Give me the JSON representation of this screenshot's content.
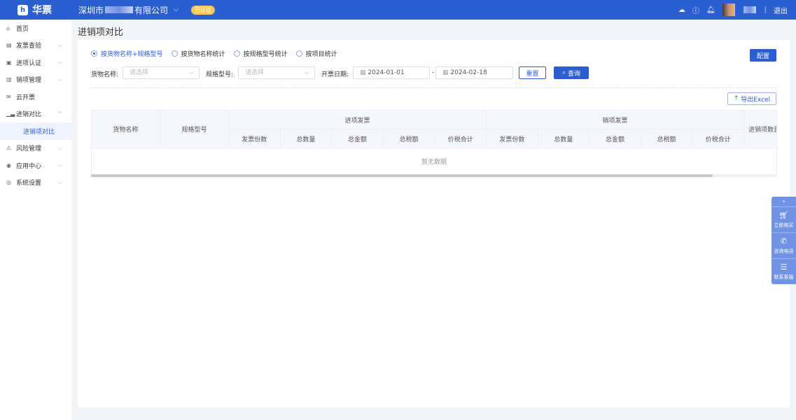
{
  "header": {
    "logo": "华票",
    "company_prefix": "深圳市",
    "company_suffix": "有限公司",
    "verified": "已认证",
    "logout": "退出",
    "icons": [
      "cloud-upload-icon",
      "help-icon",
      "bell-icon"
    ]
  },
  "sidebar": {
    "items": [
      {
        "label": "首页",
        "icon": "⌂"
      },
      {
        "label": "发票查验",
        "icon": "▤",
        "chev": "⌵"
      },
      {
        "label": "进项认证",
        "icon": "▣",
        "chev": "⌵"
      },
      {
        "label": "销项管理",
        "icon": "▥",
        "chev": "⌵"
      },
      {
        "label": "云开票",
        "icon": "✉"
      },
      {
        "label": "进销对比",
        "icon": "▁▃",
        "chev": "^"
      },
      {
        "label": "进销项对比",
        "sub": true
      },
      {
        "label": "风险管理",
        "icon": "⚠",
        "chev": "⌵"
      },
      {
        "label": "应用中心",
        "icon": "◉",
        "chev": "⌵"
      },
      {
        "label": "系统设置",
        "icon": "◎",
        "chev": "⌵"
      }
    ]
  },
  "page": {
    "title": "进销项对比"
  },
  "radios": [
    {
      "label": "按货物名称+规格型号",
      "checked": true
    },
    {
      "label": "按货物名称统计"
    },
    {
      "label": "按规格型号统计"
    },
    {
      "label": "按项目统计"
    }
  ],
  "config_label": "配置",
  "filters": {
    "goods_label": "货物名称:",
    "goods_placeholder": "请选择",
    "spec_label": "规格型号:",
    "spec_placeholder": "请选择",
    "date_label": "开票日期:",
    "date_start": "2024-01-01",
    "date_sep": "-",
    "date_end": "2024-02-18",
    "reset": "重置",
    "query": "查询"
  },
  "export_label": "导出Excel",
  "table": {
    "col_goods": "货物名称",
    "col_spec": "规格型号",
    "group_in": "进项发票",
    "group_out": "销项发票",
    "col_last": "进销项数量",
    "sub_cols": [
      "发票份数",
      "总数量",
      "总金额",
      "总税额",
      "价税合计"
    ],
    "empty": "暂无数据"
  },
  "float": {
    "items": [
      "立即购买",
      "咨询电话",
      "联系客服"
    ]
  }
}
